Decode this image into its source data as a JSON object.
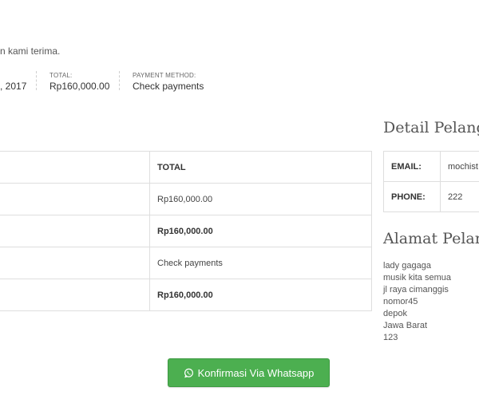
{
  "notice": "n kami terima.",
  "order_meta": {
    "date_value": ", 2017",
    "total_label": "TOTAL:",
    "total_value": "Rp160,000.00",
    "payment_label": "PAYMENT METHOD:",
    "payment_value": "Check payments"
  },
  "order_table": {
    "header": "TOTAL",
    "rows": [
      {
        "value": "Rp160,000.00"
      },
      {
        "value": "Rp160,000.00"
      },
      {
        "value": "Check payments"
      },
      {
        "value": "Rp160,000.00"
      }
    ]
  },
  "customer": {
    "title": "Detail Pelang",
    "email_label": "EMAIL:",
    "email_value": "mochist",
    "phone_label": "PHONE:",
    "phone_value": "222"
  },
  "address": {
    "title": "Alamat Pelang",
    "lines": [
      "lady gagaga",
      "musik kita semua",
      "jl raya cimanggis",
      "nomor45",
      "depok",
      "Jawa Barat",
      "123"
    ]
  },
  "actions": {
    "whatsapp_label": "Konfirmasi Via Whatsapp",
    "whatsapp_icon": "whatsapp-icon",
    "button_color": "#4caf50"
  }
}
